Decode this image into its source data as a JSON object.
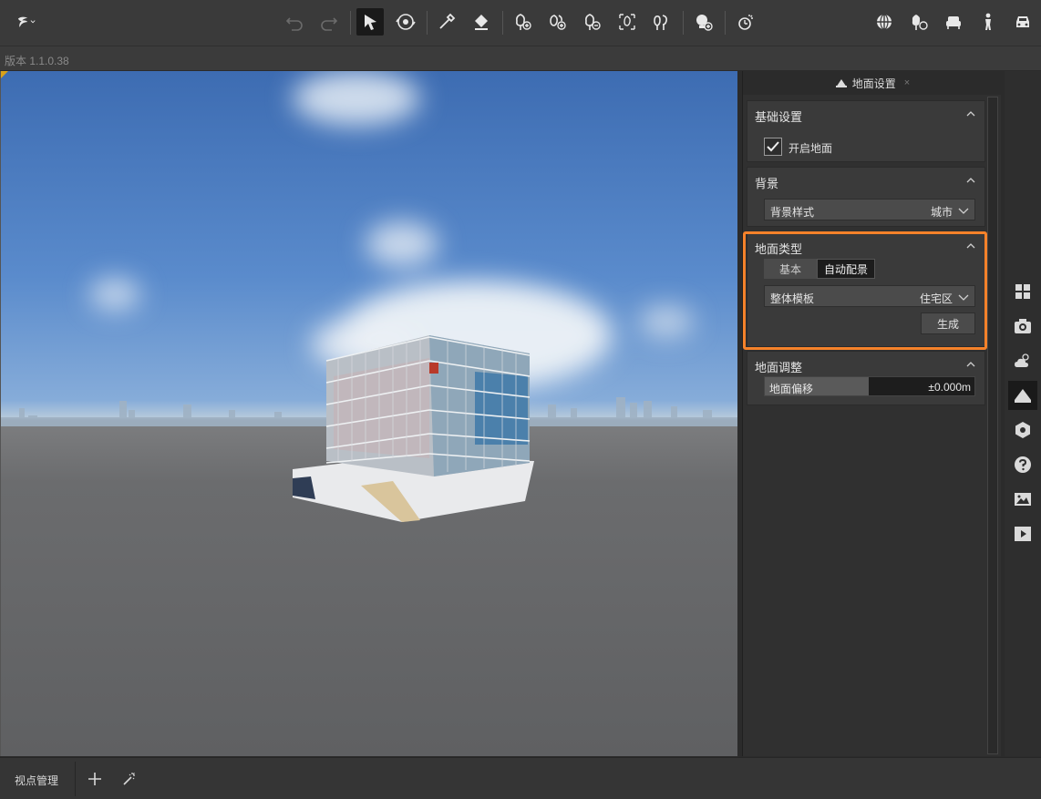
{
  "version_text": "版本 1.1.0.38",
  "panel": {
    "tab_label": "地面设置",
    "close_glyph": "×",
    "basic": {
      "title": "基础设置",
      "enable_ground_label": "开启地面",
      "enable_ground_checked": true
    },
    "background": {
      "title": "背景",
      "style_label": "背景样式",
      "style_value": "城市"
    },
    "ground_type": {
      "title": "地面类型",
      "mode_options": [
        "基本",
        "自动配景"
      ],
      "selected_mode": "自动配景",
      "template_label": "整体模板",
      "template_value": "住宅区",
      "generate_label": "生成"
    },
    "adjust": {
      "title": "地面调整",
      "offset_label": "地面偏移",
      "offset_value": "±0.000m"
    }
  },
  "bottom": {
    "viewpoint_label": "视点管理"
  },
  "colors": {
    "highlight": "#f5822a",
    "corner_mark": "#d9a21a"
  }
}
